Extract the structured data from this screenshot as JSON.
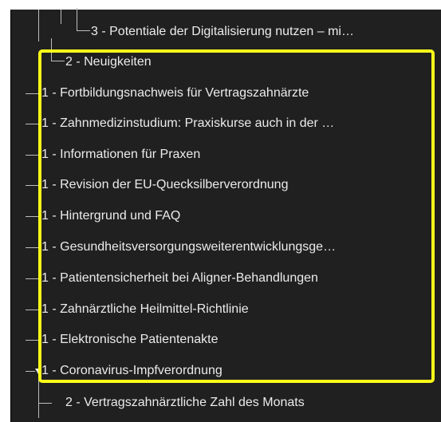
{
  "tree": {
    "items": [
      {
        "label": "3 - Potentiale der Digitalisierung nutzen – mi…",
        "level": 3
      },
      {
        "label": "2 - Neuigkeiten",
        "level": 2
      },
      {
        "label": "1 - Fortbildungsnachweis für Vertragszahnärzte",
        "level": 1
      },
      {
        "label": "1 - Zahnmedizinstudium: Praxiskurse auch in der …",
        "level": 1
      },
      {
        "label": "1 - Informationen für Praxen",
        "level": 1
      },
      {
        "label": "1 - Revision der EU-Quecksilberverordnung",
        "level": 1
      },
      {
        "label": "1 - Hintergrund und FAQ",
        "level": 1
      },
      {
        "label": "1 - Gesundheitsversorgungsweiterentwicklungsge…",
        "level": 1
      },
      {
        "label": "1 - Patientensicherheit bei Aligner-Behandlungen",
        "level": 1
      },
      {
        "label": "1 - Zahnärztliche Heilmittel-Richtlinie",
        "level": 1
      },
      {
        "label": "1 - Elektronische Patientenakte",
        "level": 1
      },
      {
        "label": "1 - Coronavirus-Impfverordnung",
        "level": 1,
        "expanded": true
      },
      {
        "label": "2 - Vertragszahnärztliche Zahl des Monats",
        "level": 2
      }
    ]
  },
  "colors": {
    "panel_background": "#202020",
    "text": "#ebebeb",
    "connector": "#bdbdbd",
    "highlight_border": "#ffff1a"
  }
}
